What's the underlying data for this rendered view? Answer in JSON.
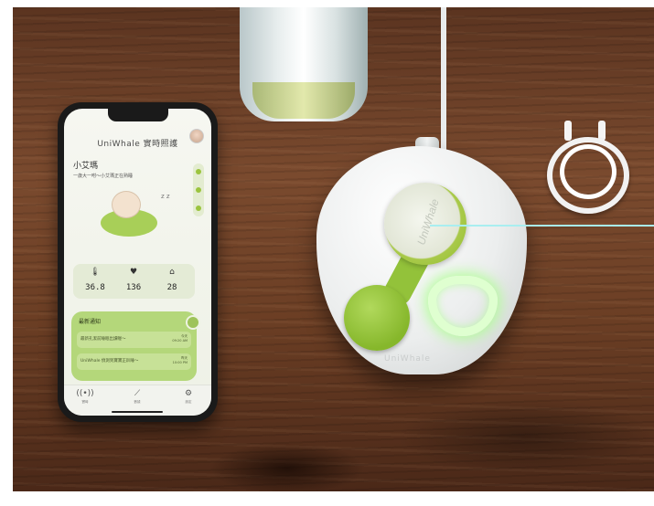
{
  "app": {
    "title": "UniWhale 實時照護",
    "baby_name": "小艾瑪",
    "baby_status": "一歲大一咐～小艾瑪正在熟睡",
    "sleep_symbol": "z z"
  },
  "vitals": [
    {
      "icon": "thermometer-icon",
      "glyph": "🌡",
      "value": "36.8"
    },
    {
      "icon": "heart-icon",
      "glyph": "♥",
      "value": "136"
    },
    {
      "icon": "lungs-icon",
      "glyph": "⌂",
      "value": "28"
    }
  ],
  "notifications": {
    "title": "最新通知",
    "items": [
      {
        "text": "最新孔潔前睡眠出讀喔～",
        "time": "今天\n09:20 AM"
      },
      {
        "text": "UniWhale 偵測到寶寶正趴睡～",
        "time": "昨天\n10:00 PM"
      }
    ]
  },
  "tabs": [
    {
      "icon": "broadcast-icon",
      "glyph": "((•))",
      "label": "實時"
    },
    {
      "icon": "chart-icon",
      "glyph": "⟋",
      "label": "數據"
    },
    {
      "icon": "gear-icon",
      "glyph": "⚙",
      "label": "設定"
    }
  ],
  "device": {
    "sensor_brand": "UniWhale",
    "base_brand": "UniWhale"
  },
  "colors": {
    "accent_green": "#9bc43e",
    "callout_cyan": "#a9eef0",
    "glow": "#dfffd0"
  }
}
